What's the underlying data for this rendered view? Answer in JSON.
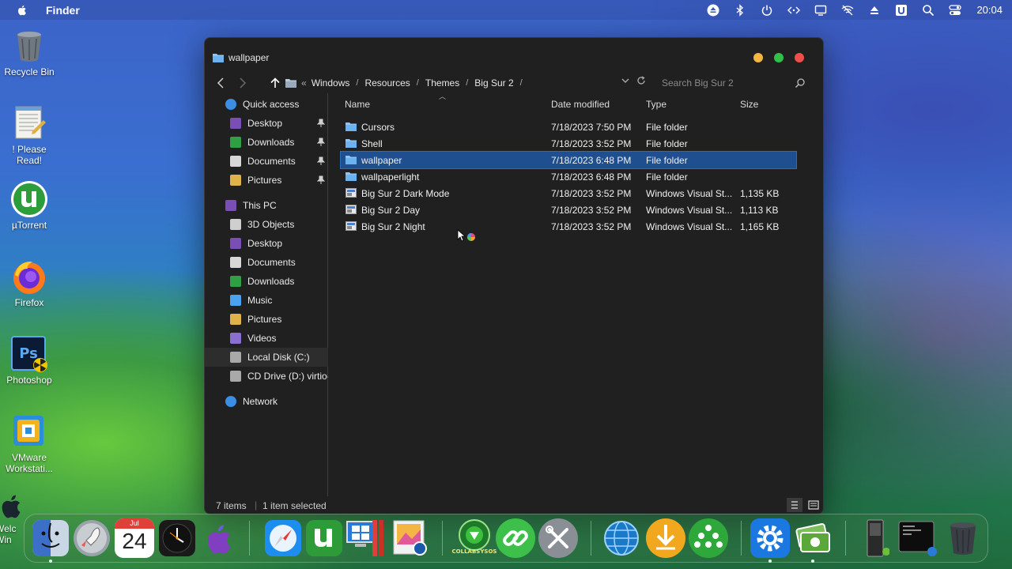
{
  "menubar": {
    "app_name": "Finder",
    "clock": "20:04",
    "icons": [
      "eject-icon",
      "bluetooth-icon",
      "power-icon",
      "code-icon",
      "display-icon",
      "wifi-off-icon",
      "upload-icon",
      "u-icon",
      "search-icon",
      "control-center-icon"
    ]
  },
  "desktop": {
    "icons": [
      {
        "label": "Recycle Bin",
        "icon": "recycle-bin-icon"
      },
      {
        "label": "! Please Read!",
        "icon": "notepad-icon"
      },
      {
        "label": "µTorrent",
        "icon": "utorrent-icon"
      },
      {
        "label": "Firefox",
        "icon": "firefox-icon"
      },
      {
        "label": "Photoshop",
        "icon": "photoshop-icon"
      },
      {
        "label": "VMware Workstati...",
        "icon": "vmware-icon"
      },
      {
        "label": "Welc Win",
        "icon": "apple-welcome-icon"
      }
    ]
  },
  "window": {
    "title": "wallpaper",
    "breadcrumb": [
      "Windows",
      "Resources",
      "Themes",
      "Big Sur 2"
    ],
    "breadcrumb_prefix": "«",
    "search_placeholder": "Search Big Sur 2",
    "sidebar": [
      {
        "label": "Quick access",
        "icon": "star-icon",
        "color": "#3a8ee6",
        "pinned": false,
        "level": 0
      },
      {
        "label": "Desktop",
        "icon": "desktop-icon",
        "color": "#7a4fb5",
        "pinned": true,
        "level": 1
      },
      {
        "label": "Downloads",
        "icon": "downloads-icon",
        "color": "#2ea043",
        "pinned": true,
        "level": 1
      },
      {
        "label": "Documents",
        "icon": "documents-icon",
        "color": "#d7d7d7",
        "pinned": true,
        "level": 1
      },
      {
        "label": "Pictures",
        "icon": "pictures-icon",
        "color": "#e0b34a",
        "pinned": true,
        "level": 1
      },
      {
        "label": "This PC",
        "icon": "this-pc-icon",
        "color": "#7a4fb5",
        "pinned": false,
        "level": 0
      },
      {
        "label": "3D Objects",
        "icon": "3d-objects-icon",
        "color": "#cfcfcf",
        "pinned": false,
        "level": 1
      },
      {
        "label": "Desktop",
        "icon": "desktop-icon",
        "color": "#7a4fb5",
        "pinned": false,
        "level": 1
      },
      {
        "label": "Documents",
        "icon": "documents-icon",
        "color": "#d7d7d7",
        "pinned": false,
        "level": 1
      },
      {
        "label": "Downloads",
        "icon": "downloads-icon",
        "color": "#2ea043",
        "pinned": false,
        "level": 1
      },
      {
        "label": "Music",
        "icon": "music-icon",
        "color": "#4aa3f0",
        "pinned": false,
        "level": 1
      },
      {
        "label": "Pictures",
        "icon": "pictures-icon",
        "color": "#e0b34a",
        "pinned": false,
        "level": 1
      },
      {
        "label": "Videos",
        "icon": "videos-icon",
        "color": "#8a6fd0",
        "pinned": false,
        "level": 1
      },
      {
        "label": "Local Disk (C:)",
        "icon": "disk-icon",
        "color": "#a9a9a9",
        "pinned": false,
        "level": 1,
        "selected": true
      },
      {
        "label": "CD Drive (D:) virtio-",
        "icon": "cd-drive-icon",
        "color": "#a9a9a9",
        "pinned": false,
        "level": 1
      },
      {
        "label": "Network",
        "icon": "network-icon",
        "color": "#3a8ee6",
        "pinned": false,
        "level": 0
      }
    ],
    "columns": {
      "name": "Name",
      "date": "Date modified",
      "type": "Type",
      "size": "Size"
    },
    "files": [
      {
        "name": "Cursors",
        "date": "7/18/2023 7:50 PM",
        "type": "File folder",
        "size": "",
        "kind": "folder",
        "selected": false
      },
      {
        "name": "Shell",
        "date": "7/18/2023 3:52 PM",
        "type": "File folder",
        "size": "",
        "kind": "folder",
        "selected": false
      },
      {
        "name": "wallpaper",
        "date": "7/18/2023 6:48 PM",
        "type": "File folder",
        "size": "",
        "kind": "folder",
        "selected": true
      },
      {
        "name": "wallpaperlight",
        "date": "7/18/2023 6:48 PM",
        "type": "File folder",
        "size": "",
        "kind": "folder",
        "selected": false
      },
      {
        "name": "Big Sur 2 Dark Mode",
        "date": "7/18/2023 3:52 PM",
        "type": "Windows Visual St...",
        "size": "1,135 KB",
        "kind": "style",
        "selected": false
      },
      {
        "name": "Big Sur 2 Day",
        "date": "7/18/2023 3:52 PM",
        "type": "Windows Visual St...",
        "size": "1,113 KB",
        "kind": "style",
        "selected": false
      },
      {
        "name": "Big Sur 2 Night",
        "date": "7/18/2023 3:52 PM",
        "type": "Windows Visual St...",
        "size": "1,165 KB",
        "kind": "style",
        "selected": false
      }
    ],
    "status": {
      "count": "7 items",
      "selection": "1 item selected"
    }
  },
  "dock": {
    "calendar_month": "Jul",
    "calendar_day": "24",
    "collabsysos_label": "COLLABSYSOS",
    "items": [
      "finder-icon",
      "launchpad-icon",
      "calendar-icon",
      "clock-icon",
      "macos-icon",
      "safari-icon",
      "utorrent-icon",
      "windows-installer-icon",
      "preview-icon",
      "collabsysos-icon",
      "link-icon",
      "system-tools-icon",
      "network-globe-icon",
      "download-arrow-icon",
      "community-icon",
      "settings-gear-icon",
      "money-icon",
      "ipod-icon",
      "terminal-icon",
      "trash-icon"
    ]
  }
}
